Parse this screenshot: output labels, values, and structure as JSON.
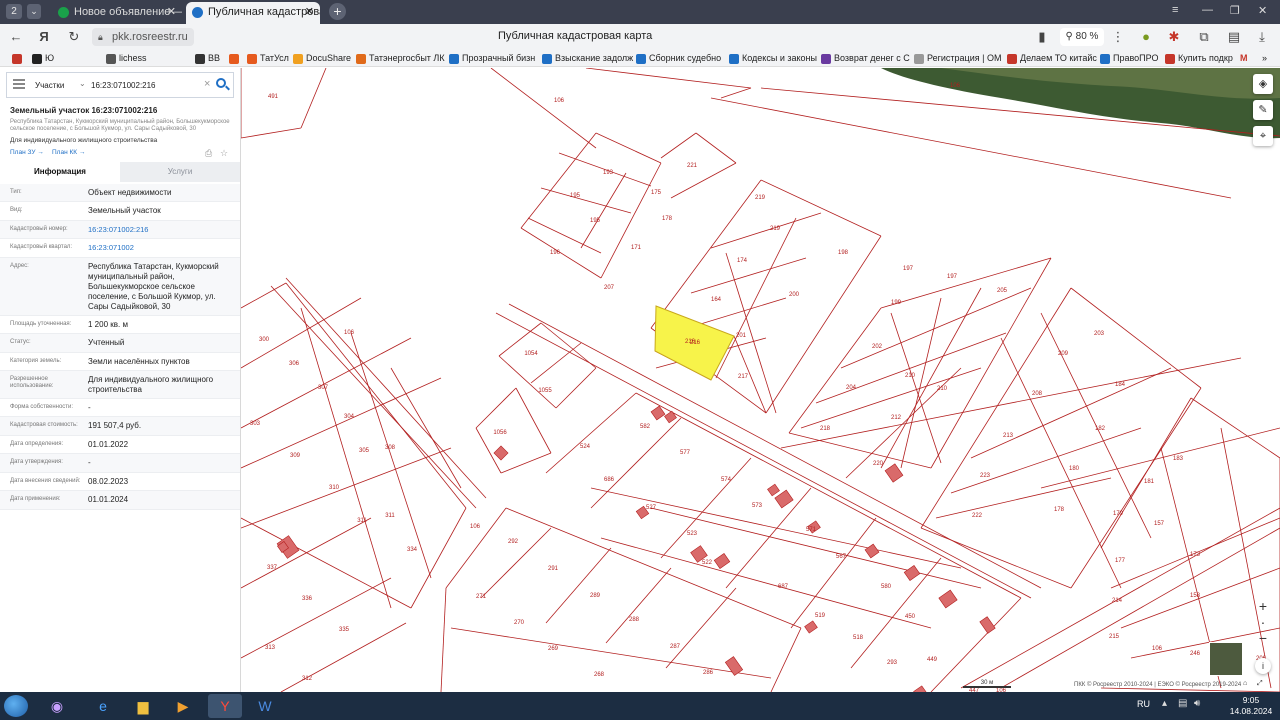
{
  "browser": {
    "tab_counter": "2",
    "tabs": [
      {
        "title": "Новое объявление — Об",
        "favicon_color": "#1aa14a"
      },
      {
        "title": "Публичная кадастровая",
        "favicon_color": "#1f6fc5"
      }
    ],
    "url": "pkk.rosreestr.ru",
    "page_title": "Публичная кадастровая карта",
    "zoom": "80 %"
  },
  "bookmarks": [
    {
      "label": "",
      "color": "#c5362a"
    },
    {
      "label": "Ю",
      "color": "#222222"
    },
    {
      "label": "lichess",
      "color": "#555555"
    },
    {
      "label": "BB",
      "color": "#333333"
    },
    {
      "label": "",
      "color": "#e65a1e"
    },
    {
      "label": "ТатУсл",
      "color": "#e65a1e"
    },
    {
      "label": "DocuShare",
      "color": "#f0a020"
    },
    {
      "label": "Татэнергосбыт ЛК",
      "color": "#e06a1a"
    },
    {
      "label": "Прозрачный бизн",
      "color": "#1f6fc5"
    },
    {
      "label": "Взыскание задолж",
      "color": "#1f6fc5"
    },
    {
      "label": "Сборник судебно",
      "color": "#1f6fc5"
    },
    {
      "label": "Кодексы и законы",
      "color": "#1f6fc5"
    },
    {
      "label": "Возврат денег с С",
      "color": "#6a3aa0"
    },
    {
      "label": "Регистрация | ОМ",
      "color": "#999999"
    },
    {
      "label": "Делаем ТО китайс",
      "color": "#c5362a"
    },
    {
      "label": "ПравоПРО",
      "color": "#1f6fc5"
    },
    {
      "label": "Купить подкр",
      "color": "#c5362a"
    }
  ],
  "search": {
    "type": "Участки",
    "query": "16:23:071002:216"
  },
  "object": {
    "title": "Земельный участок 16:23:071002:216",
    "address_line": "Республика Татарстан, Кукморский муниципальный район, Большекукморское сельское поселение, с Большой Кукмор, ул. Сары Садыйковой, 30",
    "permitted_use": "Для индивидуального жилищного строительства",
    "plan_zu": "План ЗУ →",
    "plan_kk": "План КК →"
  },
  "panel_tabs": {
    "info": "Информация",
    "services": "Услуги"
  },
  "attributes": [
    {
      "label": "Тип:",
      "value": "Объект недвижимости",
      "link": false
    },
    {
      "label": "Вид:",
      "value": "Земельный участок",
      "link": false
    },
    {
      "label": "Кадастровый номер:",
      "value": "16:23:071002:216",
      "link": true
    },
    {
      "label": "Кадастровый квартал:",
      "value": "16:23:071002",
      "link": true
    },
    {
      "label": "Адрес:",
      "value": "Республика Татарстан, Кукморский муниципальный район, Большекукморское сельское поселение, с Большой Кукмор, ул. Сары Садыйковой, 30",
      "link": false
    },
    {
      "label": "Площадь уточненная:",
      "value": "1 200 кв. м",
      "link": false
    },
    {
      "label": "Статус:",
      "value": "Учтенный",
      "link": false
    },
    {
      "label": "Категория земель:",
      "value": "Земли населённых пунктов",
      "link": false
    },
    {
      "label": "Разрешенное использование:",
      "value": "Для индивидуального жилищного строительства",
      "link": false
    },
    {
      "label": "Форма собственности:",
      "value": "-",
      "link": false
    },
    {
      "label": "Кадастровая стоимость:",
      "value": "191 507,4 руб.",
      "link": false
    },
    {
      "label": "Дата определения:",
      "value": "01.01.2022",
      "link": false
    },
    {
      "label": "Дата утверждения:",
      "value": "-",
      "link": false
    },
    {
      "label": "Дата внесения сведений:",
      "value": "08.02.2023",
      "link": false
    },
    {
      "label": "Дата применения:",
      "value": "01.01.2024",
      "link": false
    }
  ],
  "map": {
    "selected_parcel": "216",
    "parcel_labels": [
      "491",
      "106",
      "193",
      "221",
      "195",
      "175",
      "195",
      "178",
      "196",
      "171",
      "207",
      "219",
      "219",
      "174",
      "198",
      "164",
      "200",
      "201",
      "217",
      "216",
      "197",
      "197",
      "205",
      "199",
      "202",
      "210",
      "204",
      "210",
      "218",
      "212",
      "220",
      "106",
      "1054",
      "1055",
      "1056",
      "300",
      "106",
      "306",
      "307",
      "303",
      "304",
      "309",
      "305",
      "308",
      "310",
      "311",
      "311",
      "334",
      "337",
      "336",
      "335",
      "313",
      "312",
      "106",
      "292",
      "271",
      "291",
      "289",
      "270",
      "269",
      "288",
      "287",
      "268",
      "286",
      "524",
      "582",
      "577",
      "686",
      "574",
      "573",
      "527",
      "523",
      "571",
      "522",
      "567",
      "687",
      "519",
      "580",
      "518",
      "450",
      "449",
      "293",
      "447",
      "206",
      "203",
      "209",
      "184",
      "208",
      "182",
      "213",
      "180",
      "223",
      "178",
      "222",
      "183",
      "181",
      "179",
      "157",
      "177",
      "173",
      "214",
      "158",
      "215",
      "106",
      "246",
      "106"
    ],
    "scale_label": "30 м",
    "copyright": "ПКК © Росреестр 2010-2024 | ЕЭКО © Росреестр 2019-2024"
  },
  "taskbar": {
    "lang": "RU",
    "time": "9:05",
    "date": "14.08.2024"
  }
}
